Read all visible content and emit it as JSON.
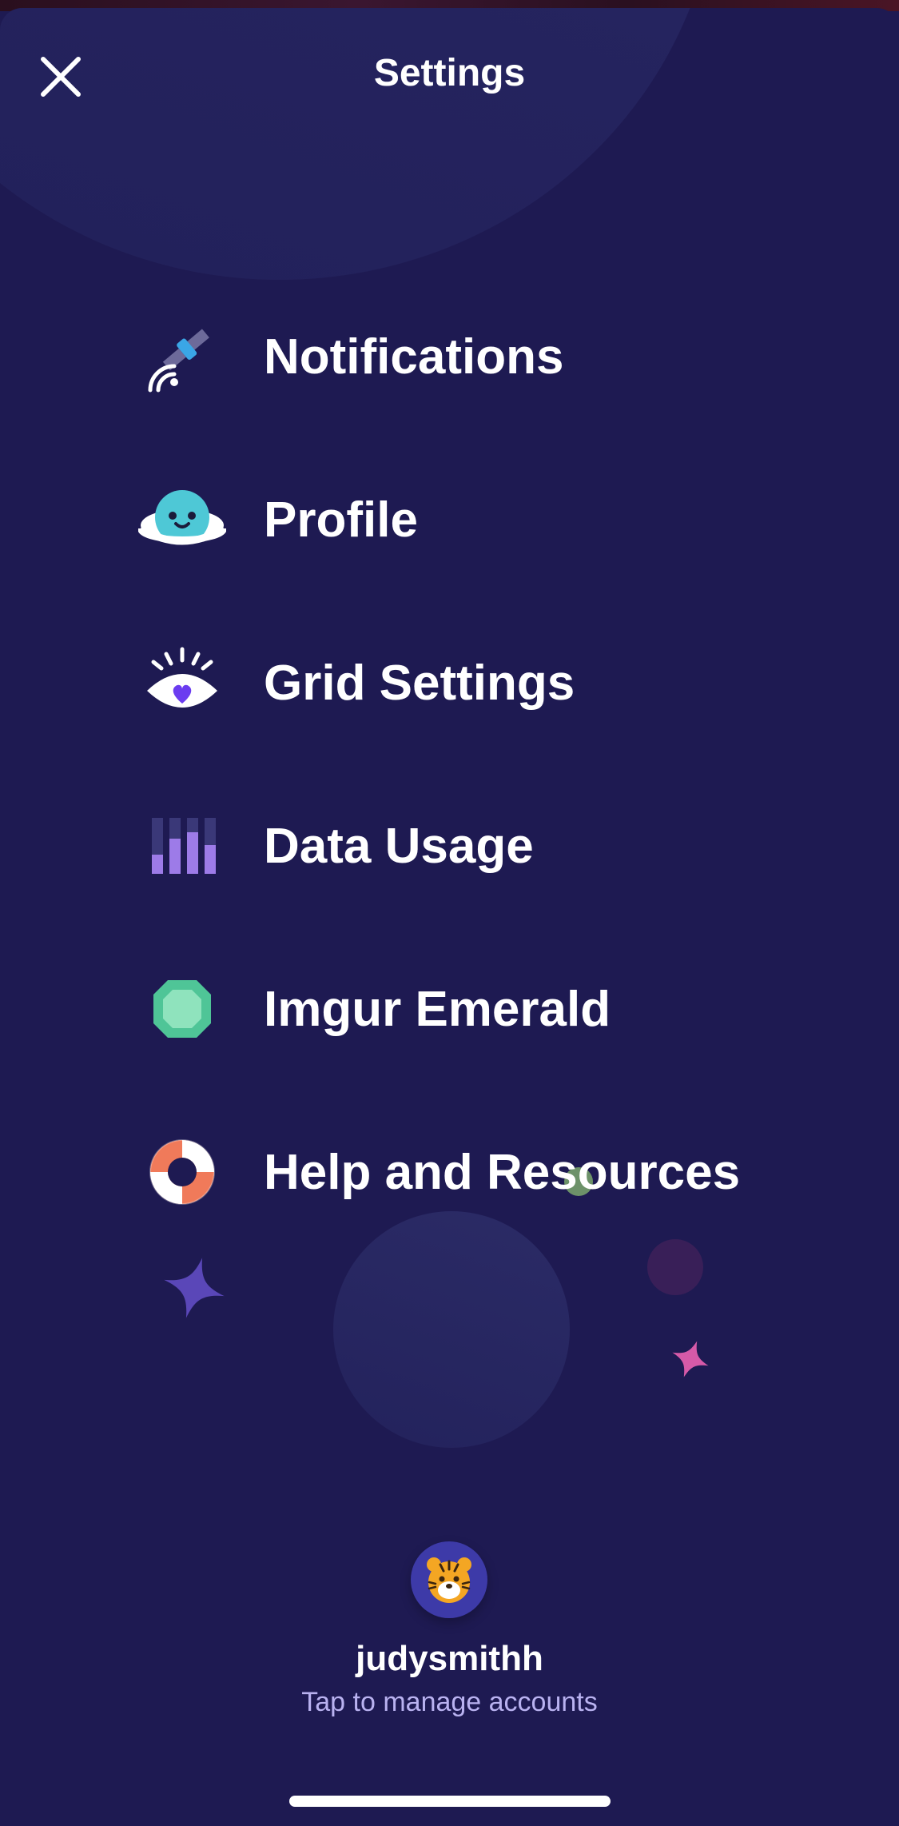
{
  "header": {
    "title": "Settings",
    "close_icon": "close-icon"
  },
  "menu": {
    "items": [
      {
        "label": "Notifications",
        "icon": "satellite-icon"
      },
      {
        "label": "Profile",
        "icon": "planet-face-icon"
      },
      {
        "label": "Grid Settings",
        "icon": "eye-heart-icon"
      },
      {
        "label": "Data Usage",
        "icon": "bar-chart-icon"
      },
      {
        "label": "Imgur Emerald",
        "icon": "emerald-gem-icon"
      },
      {
        "label": "Help and Resources",
        "icon": "lifebuoy-icon"
      }
    ]
  },
  "account": {
    "username": "judysmithh",
    "manage_text": "Tap to manage accounts",
    "avatar_icon": "tiger-avatar-icon"
  },
  "colors": {
    "background": "#1e1a52",
    "accent": "#7b5cff",
    "text": "#ffffff",
    "subtext": "#b9b2f0"
  }
}
